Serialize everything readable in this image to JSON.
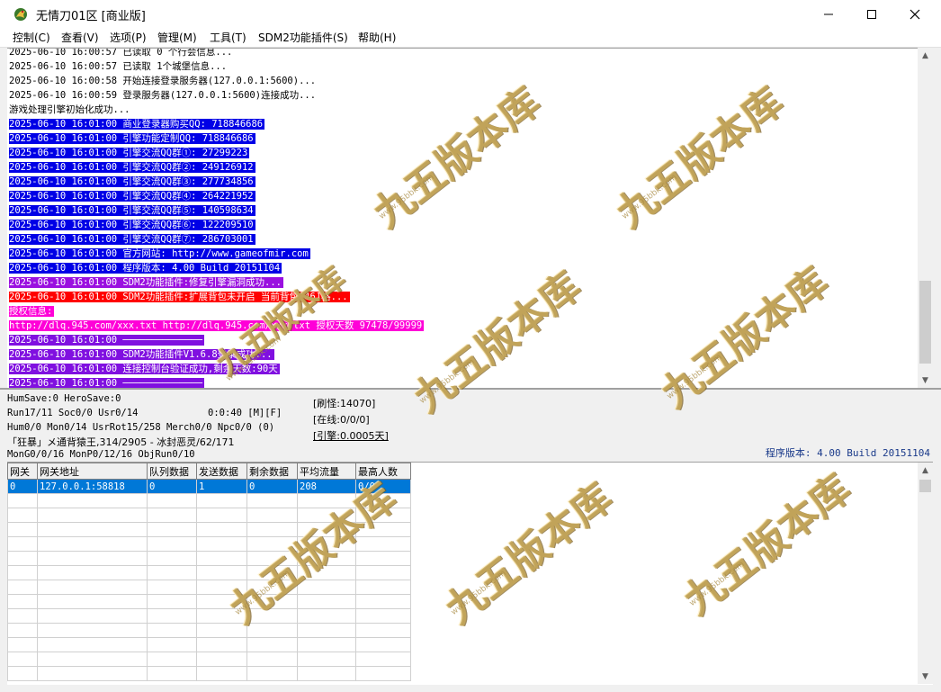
{
  "window": {
    "title": "无情刀01区 [商业版]",
    "icons": {
      "app": "dragon-app-icon",
      "minimize": "minimize-icon",
      "maximize": "maximize-icon",
      "close": "close-icon"
    }
  },
  "menu": [
    {
      "label": "控制(C)",
      "underline": "C"
    },
    {
      "label": "查看(V)",
      "underline": "V"
    },
    {
      "label": "选项(P)",
      "underline": "P"
    },
    {
      "label": "管理(M)",
      "underline": "M"
    },
    {
      "label": "工具(T)",
      "underline": "T"
    },
    {
      "label": "SDM2功能插件(S)",
      "underline": "S"
    },
    {
      "label": "帮助(H)",
      "underline": "H"
    }
  ],
  "log": [
    {
      "text": "2025-06-10 16:00:57 已读取 0 个行会信息...",
      "style": "plain"
    },
    {
      "text": "2025-06-10 16:00:57 已读取 1个城堡信息...",
      "style": "plain"
    },
    {
      "text": "2025-06-10 16:00:58 开始连接登录服务器(127.0.0.1:5600)...",
      "style": "plain"
    },
    {
      "text": "2025-06-10 16:00:59 登录服务器(127.0.0.1:5600)连接成功...",
      "style": "plain"
    },
    {
      "text": "游戏处理引擎初始化成功...",
      "style": "plain"
    },
    {
      "text": "2025-06-10 16:01:00 商业登录器购买QQ: 718846686",
      "style": "blue"
    },
    {
      "text": "2025-06-10 16:01:00 引擎功能定制QQ: 718846686",
      "style": "blue"
    },
    {
      "text": "2025-06-10 16:01:00 引擎交流QQ群①: 27299223",
      "style": "blue"
    },
    {
      "text": "2025-06-10 16:01:00 引擎交流QQ群②: 249126912",
      "style": "blue"
    },
    {
      "text": "2025-06-10 16:01:00 引擎交流QQ群③: 277734856",
      "style": "blue"
    },
    {
      "text": "2025-06-10 16:01:00 引擎交流QQ群④: 264221952",
      "style": "blue"
    },
    {
      "text": "2025-06-10 16:01:00 引擎交流QQ群⑤: 140598634",
      "style": "blue"
    },
    {
      "text": "2025-06-10 16:01:00 引擎交流QQ群⑥: 122209510",
      "style": "blue"
    },
    {
      "text": "2025-06-10 16:01:00 引擎交流QQ群⑦: 286703001",
      "style": "blue"
    },
    {
      "text": "2025-06-10 16:01:00 官方网站: http://www.gameofmir.com",
      "style": "blue"
    },
    {
      "text": "2025-06-10 16:01:00 程序版本: 4.00 Build 20151104",
      "style": "blue"
    },
    {
      "text": "2025-06-10 16:01:00 SDM2功能插件:修复引擎漏洞成功...",
      "style": "purple"
    },
    {
      "text": "2025-06-10 16:01:00 SDM2功能插件:扩展背包未开启 当前背包[46]格...",
      "style": "red"
    },
    {
      "text": "授权信息:",
      "style": "pink"
    },
    {
      "text": "http://dlq.945.com/xxx.txt http://dlq.945.com/xxx.txt 授权天数 97478/99999",
      "style": "pink"
    },
    {
      "text": "2025-06-10 16:01:00 ──────────────",
      "style": "violet"
    },
    {
      "text": "2025-06-10 16:01:00 SDM2功能插件V1.6.8登录成功...",
      "style": "violet"
    },
    {
      "text": "2025-06-10 16:01:00 连接控制台验证成功,剩余天数:90天",
      "style": "violet"
    },
    {
      "text": "2025-06-10 16:01:00 ──────────────",
      "style": "violet"
    }
  ],
  "status": {
    "line1": "HumSave:0 HeroSave:0",
    "line2": "Run17/11 Soc0/0 Usr0/14",
    "timer": "0:0:40 [M][F]",
    "line3": "Hum0/0 Mon0/14 UsrRot15/258 Merch0/0 Npc0/0 (0)",
    "line4": "「狂暴」メ通背猿王,314/2905 - 冰封恶灵/62/171",
    "line5": "MonG0/0/16 MonP0/12/16 ObjRun0/10",
    "refresh": "[刷怪:14070]",
    "online": "[在线:0/0/0]",
    "engine": "[引擎:0.0005天]",
    "version": "程序版本: 4.00 Build 20151104"
  },
  "table": {
    "headers": [
      "网关",
      "网关地址",
      "队列数据",
      "发送数据",
      "剩余数据",
      "平均流量",
      "最高人数"
    ],
    "rows": [
      [
        "0",
        "127.0.0.1:58818",
        "0",
        "1",
        "0",
        "208",
        "0/0"
      ]
    ],
    "empty_rows": 13
  },
  "watermark": {
    "text": "九五版本库",
    "url": "www.95bbk.com"
  }
}
